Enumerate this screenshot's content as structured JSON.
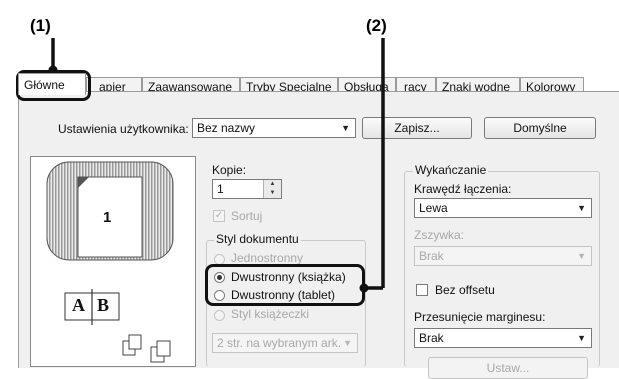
{
  "callouts": {
    "one": "(1)",
    "two": "(2)"
  },
  "tabs": [
    "Główne",
    "apier",
    "Zaawansowane",
    "Tryby Specjalne",
    "Obsługa",
    "racy",
    "Znaki wodne",
    "Kolorowy"
  ],
  "user_settings": {
    "label": "Ustawienia użytkownika:",
    "value": "Bez nazwy",
    "save": "Zapisz...",
    "default": "Domyślne"
  },
  "preview": {
    "page_number": "1",
    "booklet_left": "A",
    "booklet_right": "B"
  },
  "copies": {
    "label": "Kopie:",
    "value": "1"
  },
  "collate": {
    "label": "Sortuj",
    "checked": true
  },
  "doc_style": {
    "legend": "Styl dokumentu",
    "options": [
      "Jednostronny",
      "Dwustronny (książka)",
      "Dwustronny (tablet)",
      "Styl książeczki"
    ],
    "selected": "Dwustronny (książka)"
  },
  "pages_per_sheet": {
    "value": "2 str. na wybranym ark."
  },
  "finishing": {
    "legend": "Wykańczanie",
    "binding_label": "Krawędź łączenia:",
    "binding_value": "Lewa",
    "staple_label": "Zszywka:",
    "staple_value": "Brak",
    "offset_label": "Bez offsetu",
    "margin_label": "Przesunięcie marginesu:",
    "margin_value": "Brak",
    "set_button": "Ustaw..."
  }
}
